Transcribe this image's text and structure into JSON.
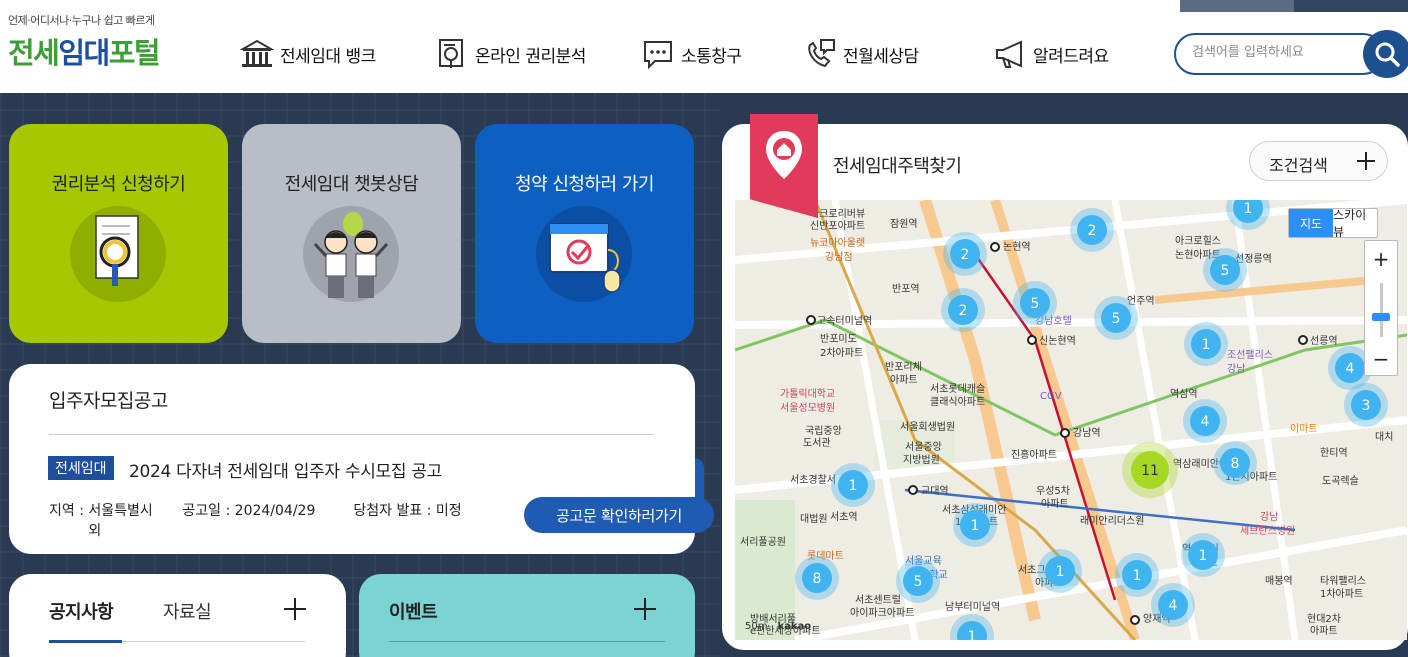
{
  "header": {
    "logo_tagline": "언제·어디서나·누구나 쉽고 빠르게",
    "logo_part1": "전세",
    "logo_part2": "임대",
    "logo_part3": "포털",
    "nav": [
      {
        "label": "전세임대 뱅크",
        "icon": "bank-icon"
      },
      {
        "label": "온라인 권리분석",
        "icon": "document-search-icon"
      },
      {
        "label": "소통창구",
        "icon": "chat-bubble-icon"
      },
      {
        "label": "전월세상담",
        "icon": "phone-chat-icon"
      },
      {
        "label": "알려드려요",
        "icon": "megaphone-icon"
      }
    ],
    "search_placeholder": "검색어를 입력하세요"
  },
  "cards": [
    {
      "title": "권리분석 신청하기",
      "icon": "magnifier-document-icon",
      "color": "#a7c700"
    },
    {
      "title": "전세임대 챗봇상담",
      "icon": "chatbot-characters-icon",
      "color": "#b9bdc6"
    },
    {
      "title": "청약 신청하러 가기",
      "icon": "browser-check-icon",
      "color": "#0e5fc2"
    }
  ],
  "notice": {
    "title": "입주자모집공고",
    "badge": "전세임대",
    "post_title": "2024 다자녀 전세임대 입주자 수시모집 공고",
    "region_label": "지역 : ",
    "region_value": "서울특별시 외",
    "date_label": "공고일 : ",
    "date_value": "2024/04/29",
    "announce_label": "당첨자 발표 : ",
    "announce_value": "미정",
    "button": "공고문 확인하러가기"
  },
  "board": {
    "tab_active": "공지사항",
    "tab_inactive": "자료실"
  },
  "event": {
    "title": "이벤트"
  },
  "map_panel": {
    "title": "전세임대주택찾기",
    "condition_button": "조건검색",
    "map_type_map": "지도",
    "map_type_sky": "스카이뷰",
    "zoom_in": "+",
    "zoom_out": "−",
    "credit_scale": "50m",
    "credit_brand": "kakao",
    "clusters": [
      {
        "count": "1",
        "area": "north"
      },
      {
        "count": "2",
        "area": "논현역"
      },
      {
        "count": "2",
        "area": "논현역 north"
      },
      {
        "count": "5",
        "area": "선정릉역"
      },
      {
        "count": "2",
        "area": "반포"
      },
      {
        "count": "5",
        "area": "강남호텔"
      },
      {
        "count": "5",
        "area": "언주역"
      },
      {
        "count": "1",
        "area": "조선팰리스"
      },
      {
        "count": "4",
        "area": "이마트"
      },
      {
        "count": "3",
        "area": "대치"
      },
      {
        "count": "4",
        "area": "역삼역"
      },
      {
        "count": "11",
        "area": "역삼래미안"
      },
      {
        "count": "8",
        "area": "역삼래미안 east"
      },
      {
        "count": "1",
        "area": "서초경찰서"
      },
      {
        "count": "1",
        "area": "교대역"
      },
      {
        "count": "8",
        "area": "서초"
      },
      {
        "count": "5",
        "area": "서울교대"
      },
      {
        "count": "1",
        "area": "서초그랑자이"
      },
      {
        "count": "1",
        "area": "래미안리더스원"
      },
      {
        "count": "1",
        "area": "역삼자이"
      },
      {
        "count": "4",
        "area": "양재역"
      },
      {
        "count": "1",
        "area": "남부터미널"
      }
    ],
    "labels": [
      "아크로리버뷰",
      "신반포아파트",
      "잠원역",
      "뉴코아아울렛",
      "강남점",
      "논현역",
      "반포역",
      "고속터미널역",
      "반포미도",
      "2차아파트",
      "반포리체",
      "아파트",
      "신논현역",
      "강남호텔",
      "언주역",
      "아크로힐스",
      "논현아파트",
      "선정릉역",
      "선릉역",
      "조선팰리스",
      "강남",
      "가톨릭대학교",
      "서울성모병원",
      "서초롯데캐슬",
      "클래식아파트",
      "CGV",
      "역삼역",
      "이마트",
      "국립중앙",
      "도서관",
      "서울회생법원",
      "서울중앙",
      "지방법원",
      "강남역",
      "서초경찰서",
      "교대역",
      "진흥아파트",
      "우성5차",
      "아파트",
      "역삼래미안아파트",
      "1단지아파트",
      "한티역",
      "도곡렉슬",
      "대법원",
      "서초역",
      "서초삼성래미안",
      "1차아파트",
      "래미안리더스원",
      "강남",
      "세브란스병원",
      "서리풀공원",
      "롯데마트",
      "서울교육",
      "대학교",
      "서초그랑자이",
      "아파트",
      "역삼자이",
      "아파트",
      "매봉역",
      "타워팰리스",
      "1차아파트",
      "방배서리풀",
      "e편한세상아파트",
      "서초센트럴",
      "아이파크아파트",
      "남부터미널역",
      "양재역",
      "현대2차",
      "아파트",
      "대치"
    ]
  },
  "colors": {
    "brand_blue": "#1e4f8f",
    "map_accent": "#e23a5a",
    "cluster": "#40b4f0",
    "cluster_large": "#a6d821"
  }
}
